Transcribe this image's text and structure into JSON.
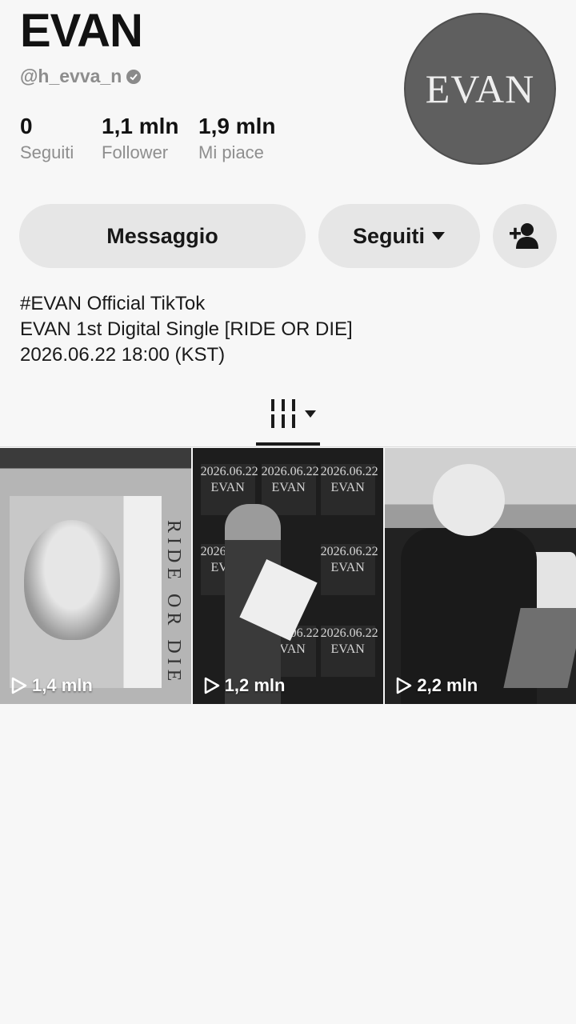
{
  "profile": {
    "name": "EVAN",
    "handle": "@h_evva_n",
    "avatar_text": "EVAN",
    "stats": [
      {
        "value": "0",
        "label": "Seguiti"
      },
      {
        "value": "1,1 mln",
        "label": "Follower"
      },
      {
        "value": "1,9 mln",
        "label": "Mi piace"
      }
    ]
  },
  "actions": {
    "message_label": "Messaggio",
    "following_label": "Seguiti"
  },
  "bio": {
    "line1": "#EVAN Official TikTok",
    "line2": "EVAN 1st Digital Single [RIDE OR DIE]",
    "line3": "2026.06.22 18:00 (KST)"
  },
  "tiles": [
    {
      "views": "1,4 mln",
      "poster_text": "RIDE OR DIE"
    },
    {
      "views": "1,2 mln",
      "cell_date": "2026.06.22",
      "cell_text": "EVAN"
    },
    {
      "views": "2,2 mln"
    }
  ],
  "colors": {
    "background": "#f7f7f7",
    "button": "#e6e6e6",
    "secondary_text": "#8e8e8e"
  },
  "icons": [
    "verified-badge-icon",
    "caret-down-icon",
    "add-friend-icon",
    "grid-view-icon",
    "play-icon"
  ]
}
